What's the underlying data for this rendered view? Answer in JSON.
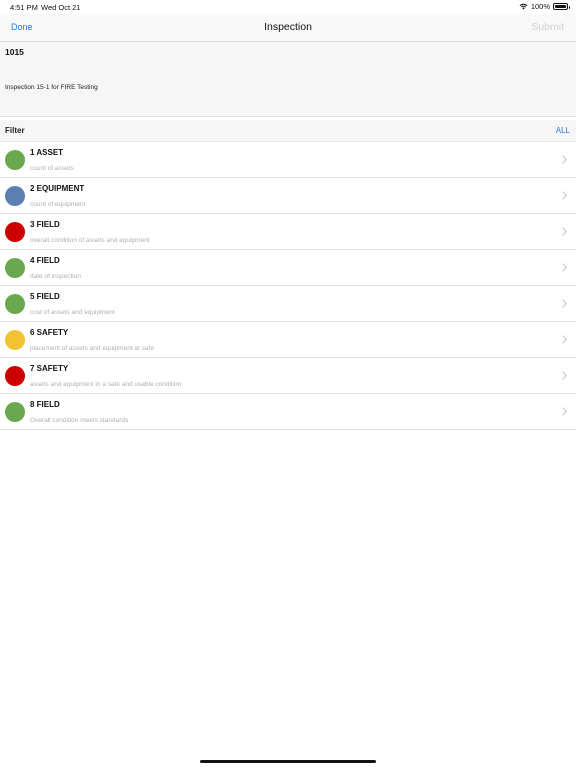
{
  "status_bar": {
    "time": "4:51 PM",
    "date": "Wed Oct 21",
    "battery": "100%"
  },
  "nav": {
    "done_label": "Done",
    "title": "Inspection",
    "submit_label": "Submit"
  },
  "header": {
    "id": "1015",
    "description": "Inspection 15-1 for FIRE Testing"
  },
  "filter": {
    "label": "Filter",
    "all_label": "ALL"
  },
  "colors": {
    "accent": "#2a7ad8",
    "green": "#6aa84f",
    "blue": "#5b7fb0",
    "red": "#cc0000",
    "yellow": "#f1c232"
  },
  "items": [
    {
      "title": "1  ASSET",
      "subtitle": "count of assets",
      "status_color": "#6aa84f"
    },
    {
      "title": "2  EQUIPMENT",
      "subtitle": "count of equipment",
      "status_color": "#5b7fb0"
    },
    {
      "title": "3  FIELD",
      "subtitle": "overall condition of assets and equipment",
      "status_color": "#cc0000"
    },
    {
      "title": "4  FIELD",
      "subtitle": "date of inspection",
      "status_color": "#6aa84f"
    },
    {
      "title": "5  FIELD",
      "subtitle": "cost of assets and equipment",
      "status_color": "#6aa84f"
    },
    {
      "title": "6  SAFETY",
      "subtitle": "placement of assets and equipment at safe",
      "status_color": "#f1c232"
    },
    {
      "title": "7  SAFETY",
      "subtitle": "assets and equipment in a safe and usable condition",
      "status_color": "#cc0000"
    },
    {
      "title": "8  FIELD",
      "subtitle": "Overall condition meets standards",
      "status_color": "#6aa84f"
    }
  ]
}
